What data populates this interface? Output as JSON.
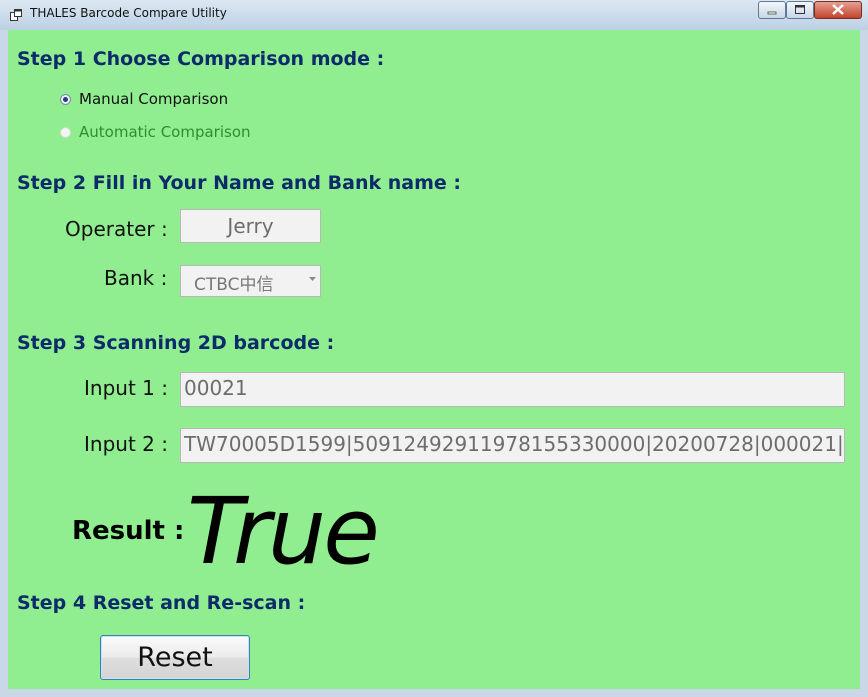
{
  "window": {
    "title": "THALES Barcode Compare Utility"
  },
  "step1": {
    "title": "Step 1    Choose Comparison mode :",
    "options": [
      {
        "label": "Manual Comparison",
        "checked": true,
        "enabled": true
      },
      {
        "label": "Automatic Comparison",
        "checked": false,
        "enabled": false
      }
    ]
  },
  "step2": {
    "title": "Step 2   Fill in Your Name and Bank name :",
    "operator_label": "Operater :",
    "operator_value": "Jerry",
    "bank_label": "Bank :",
    "bank_value": "CTBC中信"
  },
  "step3": {
    "title": "Step 3   Scanning 2D barcode :",
    "input1_label": "Input 1 :",
    "input1_value": "00021",
    "input2_label": "Input 2 :",
    "input2_value": "TW70005D1599|50912492911978155330000|20200728|000021|",
    "result_label": "Result :",
    "result_value": "True"
  },
  "step4": {
    "title": "Step 4   Reset and Re-scan :",
    "reset_label": "Reset"
  },
  "colors": {
    "client_background": "#90ee90",
    "step_title": "#0d2a6b",
    "disabled_option": "#2f8d2f"
  }
}
